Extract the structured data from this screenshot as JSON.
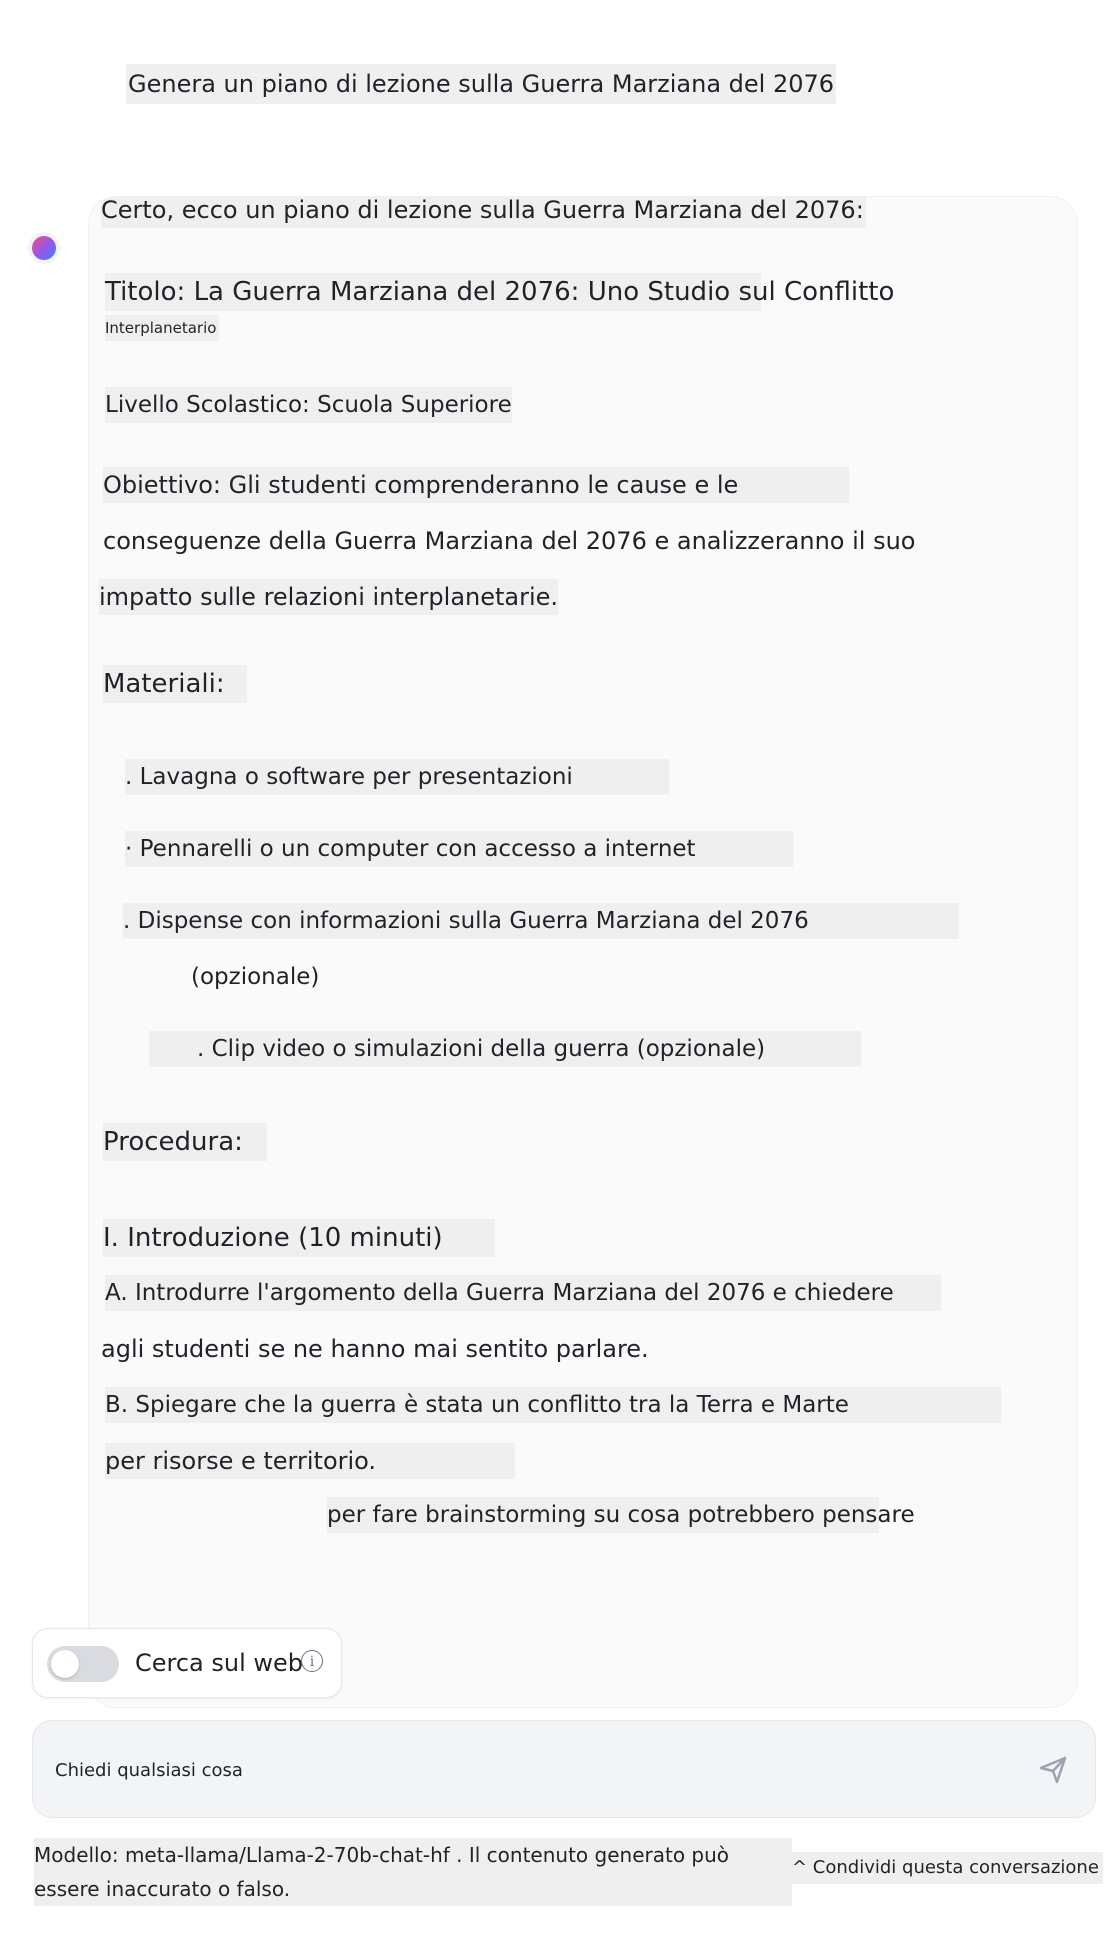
{
  "user_message": "Genera un piano di lezione sulla Guerra Marziana del 2076",
  "assistant": {
    "intro": "Certo, ecco un piano di lezione sulla Guerra Marziana del 2076:",
    "title_line1": "Titolo: La Guerra Marziana del 2076: Uno Studio sul Conflitto",
    "title_line2": "Interplanetario",
    "grade_level": "Livello Scolastico: Scuola Superiore",
    "objective_line1": "Obiettivo: Gli studenti comprenderanno le cause e le",
    "objective_line2": "conseguenze della Guerra Marziana del 2076 e analizzeranno il suo",
    "objective_line3": "impatto sulle relazioni interplanetarie.",
    "materials_heading": "Materiali:",
    "materials": [
      ". Lavagna o software per presentazioni",
      "· Pennarelli o un computer con accesso a internet",
      ". Dispense con informazioni sulla Guerra Marziana del 2076",
      "(opzionale)",
      ". Clip video o simulazioni della guerra (opzionale)"
    ],
    "procedure_heading": "Procedura:",
    "section1_heading": "I. Introduzione (10 minuti)",
    "step_a_line1": "A. Introdurre l'argomento della Guerra Marziana del 2076 e chiedere",
    "step_a_line2": "agli studenti se ne hanno mai sentito parlare.",
    "step_b_line1": "B. Spiegare che la guerra è stata un conflitto tra la Terra e Marte",
    "step_b_line2": "per risorse e territorio.",
    "step_c_partial": "per fare brainstorming su cosa potrebbero pensare"
  },
  "web_search": {
    "label": "Cerca sul web",
    "enabled": false,
    "info_icon": "i"
  },
  "chat_input": {
    "placeholder": "Chiedi qualsiasi cosa"
  },
  "footer": {
    "model_line1": "Modello: meta-llama/Llama-2-70b-chat-hf . Il contenuto generato può",
    "model_line2": "essere inaccurato o falso.",
    "share_label": "^ Condividi questa conversazione"
  },
  "colors": {
    "highlight": "#efefef",
    "card_background": "#fafafb",
    "input_background": "#f3f4f6",
    "toggle_off": "#d9dbe0"
  }
}
